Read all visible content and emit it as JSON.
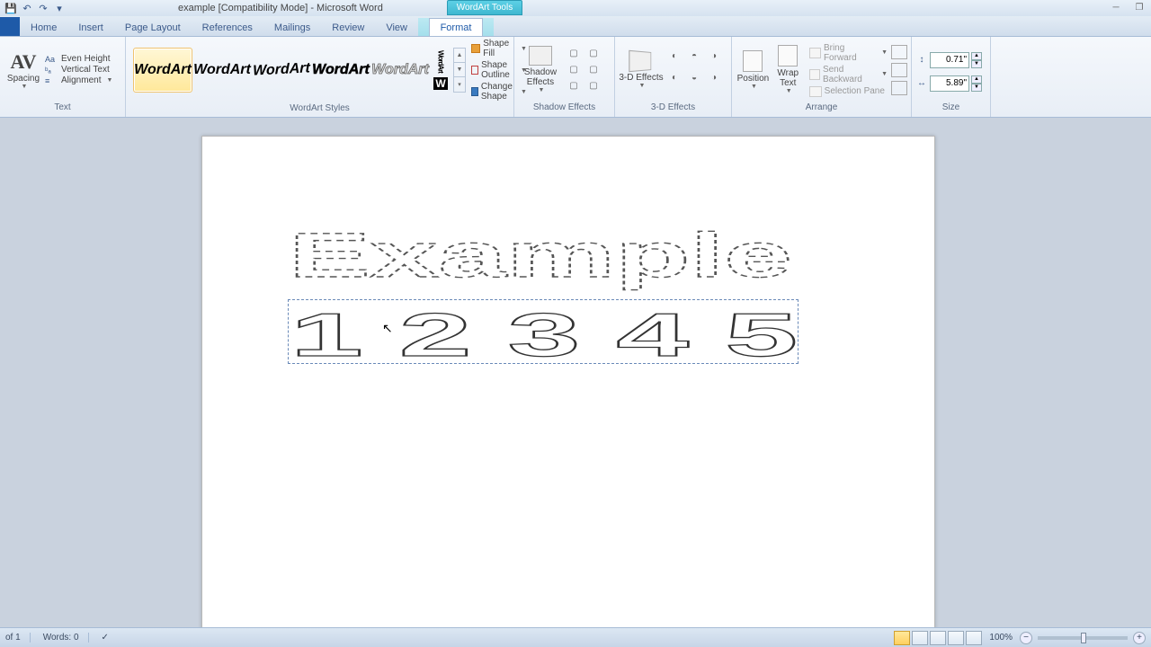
{
  "title": "example [Compatibility Mode] - Microsoft Word",
  "contextual_tab": "WordArt Tools",
  "tabs": {
    "home": "Home",
    "insert": "Insert",
    "page_layout": "Page Layout",
    "references": "References",
    "mailings": "Mailings",
    "review": "Review",
    "view": "View",
    "format": "Format"
  },
  "ribbon": {
    "text": {
      "spacing": "Spacing",
      "even_height": "Even Height",
      "vertical_text": "Vertical Text",
      "alignment": "Alignment",
      "group_label": "Text"
    },
    "styles": {
      "gallery_item": "WordArt",
      "shape_fill": "Shape Fill",
      "shape_outline": "Shape Outline",
      "change_shape": "Change Shape",
      "group_label": "WordArt Styles"
    },
    "shadow": {
      "label": "Shadow Effects",
      "group_label": "Shadow Effects"
    },
    "threed": {
      "label": "3-D Effects",
      "group_label": "3-D Effects"
    },
    "arrange": {
      "position": "Position",
      "wrap_text": "Wrap Text",
      "bring_forward": "Bring Forward",
      "send_backward": "Send Backward",
      "selection_pane": "Selection Pane",
      "group_label": "Arrange"
    },
    "size": {
      "height": "0.71\"",
      "width": "5.89\"",
      "group_label": "Size"
    }
  },
  "document": {
    "wordart1": "Example",
    "wordart2": "1 2 3 4 5"
  },
  "status": {
    "page": "of 1",
    "words": "Words: 0",
    "zoom": "100%"
  }
}
